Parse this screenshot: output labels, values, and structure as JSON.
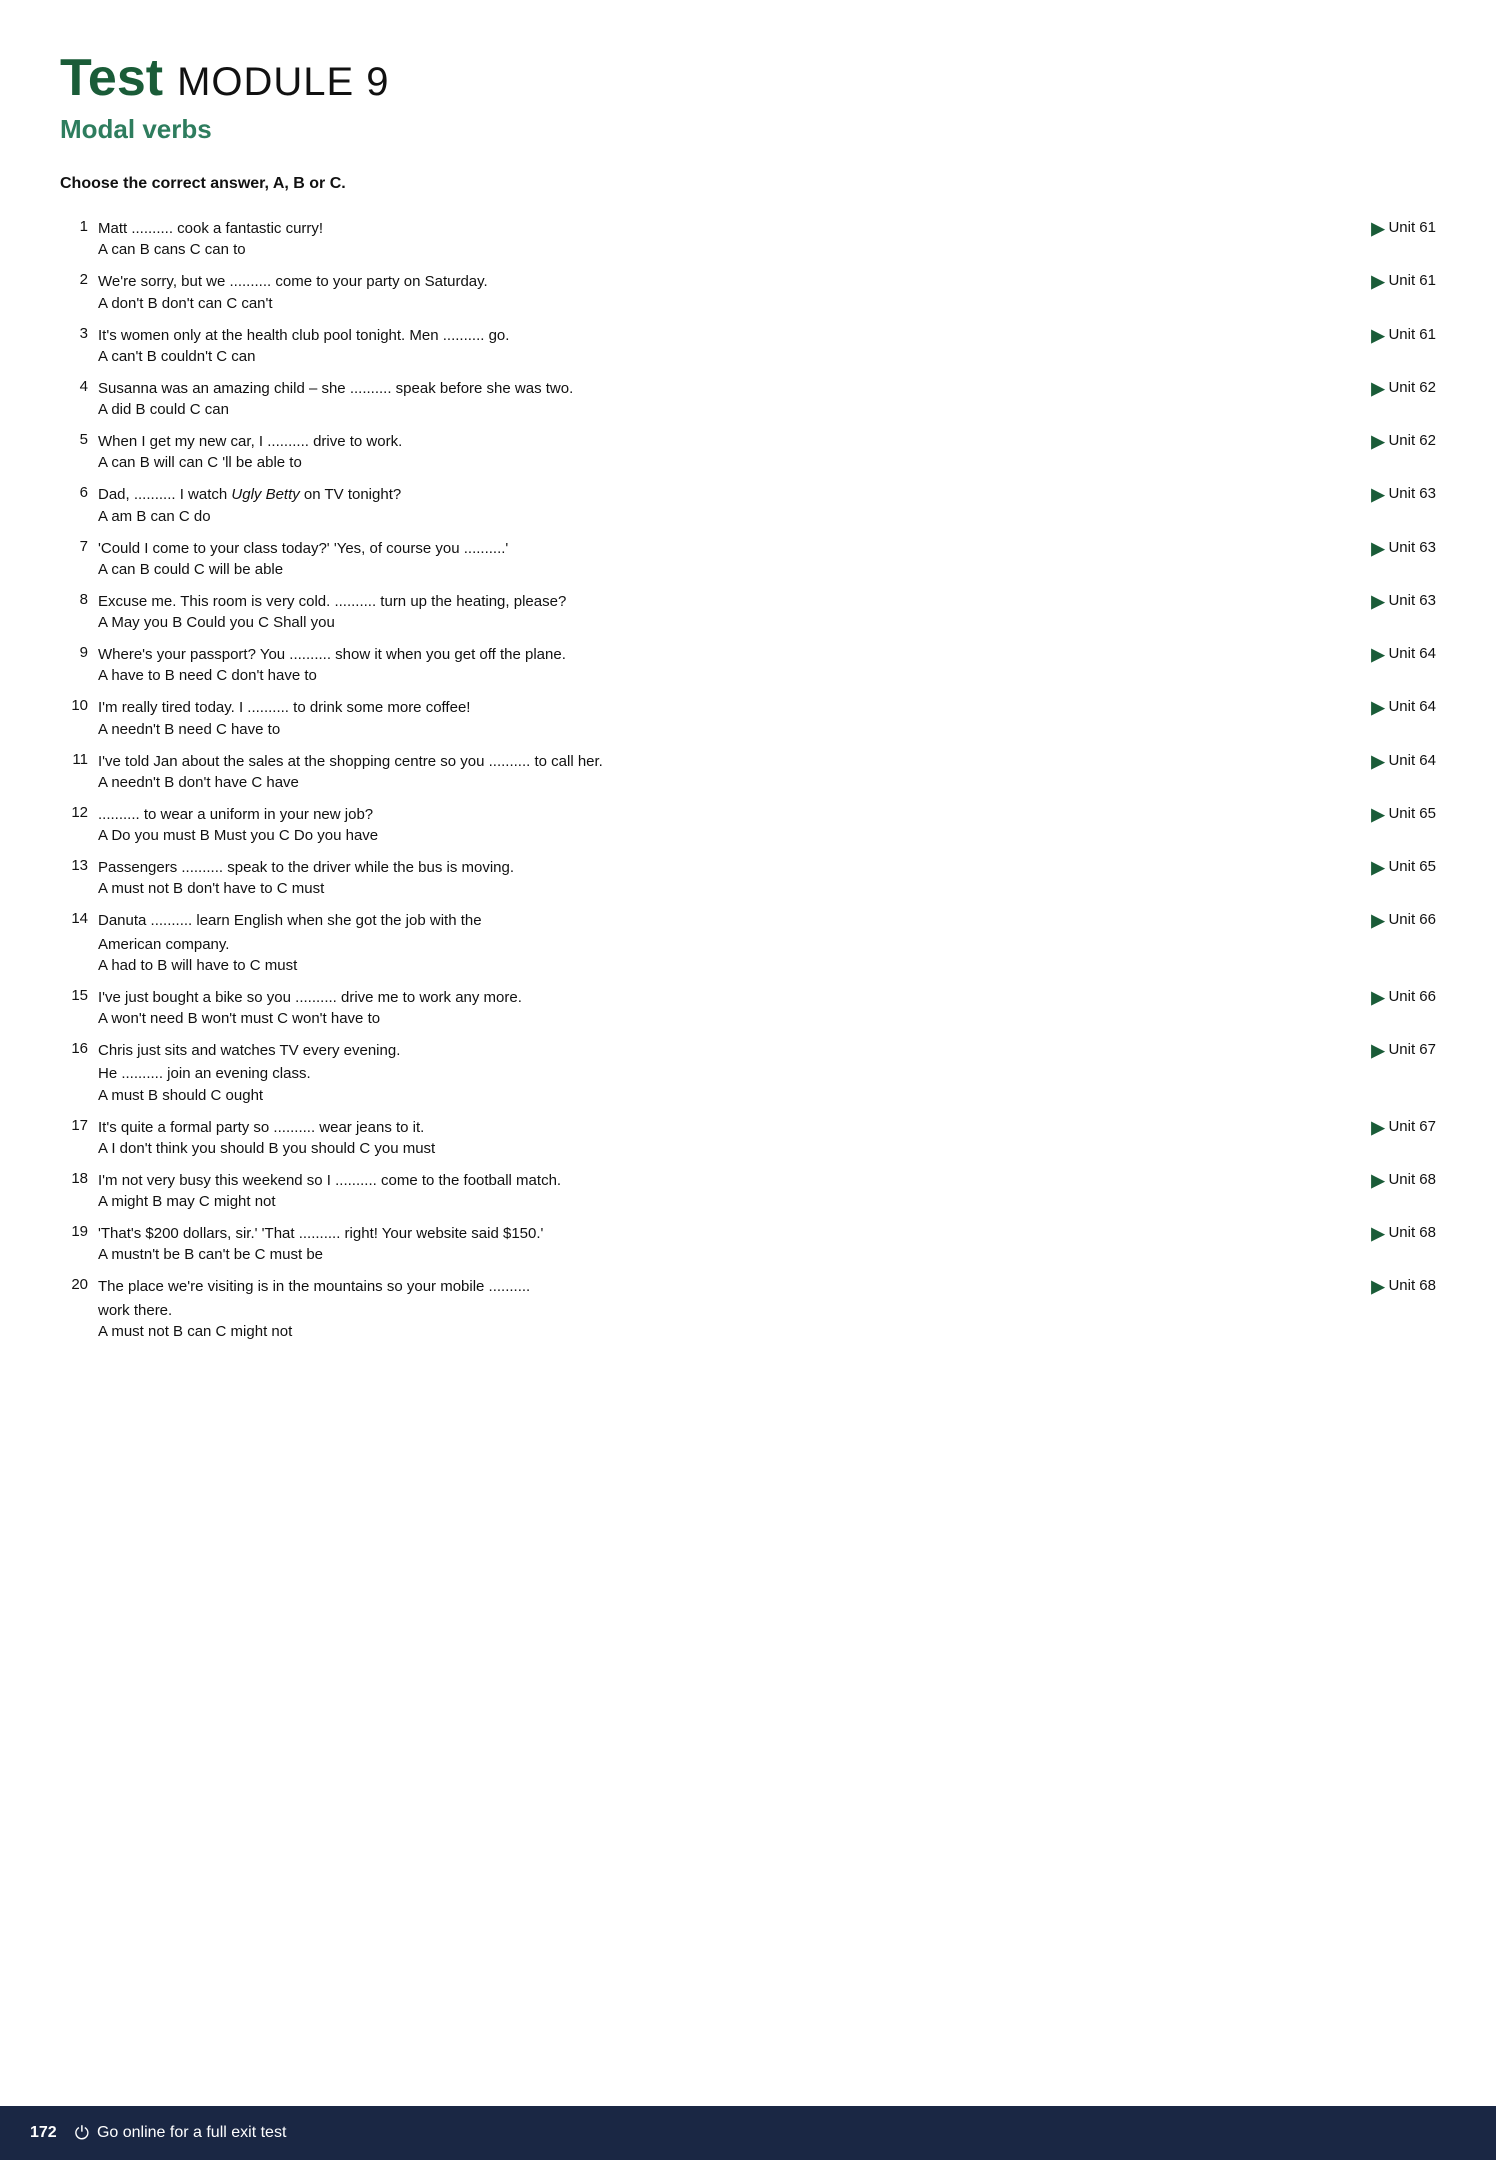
{
  "header": {
    "title_bold": "Test",
    "title_regular": "MODULE 9",
    "subtitle": "Modal verbs"
  },
  "instruction": "Choose the correct answer, A, B or C.",
  "questions": [
    {
      "number": "1",
      "main": "Matt .......... cook a fantastic curry!",
      "options": "A can  B cans  C can to",
      "unit": "Unit 61"
    },
    {
      "number": "2",
      "main": "We're sorry, but we .......... come to your party on Saturday.",
      "options": "A don't  B don't can  C can't",
      "unit": "Unit 61"
    },
    {
      "number": "3",
      "main": "It's women only at the health club pool tonight. Men .......... go.",
      "options": "A can't  B couldn't  C can",
      "unit": "Unit 61"
    },
    {
      "number": "4",
      "main": "Susanna was an amazing child – she .......... speak before she was two.",
      "options": "A did  B could  C can",
      "unit": "Unit 62"
    },
    {
      "number": "5",
      "main": "When I get my new car, I .......... drive to work.",
      "options": "A can  B will can  C 'll be able to",
      "unit": "Unit 62"
    },
    {
      "number": "6",
      "main": "Dad, .......... I watch Ugly Betty on TV tonight?",
      "options": "A am  B can  C do",
      "unit": "Unit 63",
      "italic_part": "Ugly Betty"
    },
    {
      "number": "7",
      "main": "'Could I come to your class today?' 'Yes, of course you ..........'",
      "options": "A can  B could  C will be able",
      "unit": "Unit 63"
    },
    {
      "number": "8",
      "main": "Excuse me. This room is very cold. .......... turn up the heating, please?",
      "options": "A May you  B Could you  C Shall you",
      "unit": "Unit 63"
    },
    {
      "number": "9",
      "main": "Where's your passport? You .......... show it when you get off the plane.",
      "options": "A have to  B need  C don't have to",
      "unit": "Unit 64"
    },
    {
      "number": "10",
      "main": "I'm really tired today. I .......... to drink some more coffee!",
      "options": "A needn't  B need  C have to",
      "unit": "Unit 64"
    },
    {
      "number": "11",
      "main": "I've told Jan about the sales at the shopping centre so you .......... to call her.",
      "options": "A needn't  B don't have  C have",
      "unit": "Unit 64"
    },
    {
      "number": "12",
      "main": ".......... to wear a uniform in your new job?",
      "options": "A Do you must  B Must you  C Do you have",
      "unit": "Unit 65"
    },
    {
      "number": "13",
      "main": "Passengers .......... speak to the driver while the bus is moving.",
      "options": "A must not  B don't have to  C must",
      "unit": "Unit 65"
    },
    {
      "number": "14",
      "main": "Danuta .......... learn English when she got the job with the American company.",
      "options": "A had to  B will have to  C must",
      "unit": "Unit 66",
      "multiline": true
    },
    {
      "number": "15",
      "main": "I've just bought a bike so you .......... drive me to work any more.",
      "options": "A won't need  B won't must  C won't have to",
      "unit": "Unit 66"
    },
    {
      "number": "16",
      "main": "Chris just sits and watches TV every evening.\nHe .......... join an evening class.",
      "options": "A must  B should  C ought",
      "unit": "Unit 67",
      "multiline": true
    },
    {
      "number": "17",
      "main": "It's quite a formal party so .......... wear jeans to it.",
      "options": "A I don't think you should  B you should  C you must",
      "unit": "Unit 67"
    },
    {
      "number": "18",
      "main": "I'm not very busy this weekend so I .......... come to the football match.",
      "options": "A might  B may  C might not",
      "unit": "Unit 68"
    },
    {
      "number": "19",
      "main": "'That's $200 dollars, sir.' 'That .......... right! Your website said $150.'",
      "options": "A mustn't be  B can't be  C must be",
      "unit": "Unit 68"
    },
    {
      "number": "20",
      "main": "The place we're visiting is in the mountains so your mobile .......... work there.",
      "options": "A must not  B can  C might not",
      "unit": "Unit 68",
      "multiline": true
    }
  ],
  "footer": {
    "page_number": "172",
    "icon": "⏻",
    "text": "Go online for a full exit test"
  }
}
